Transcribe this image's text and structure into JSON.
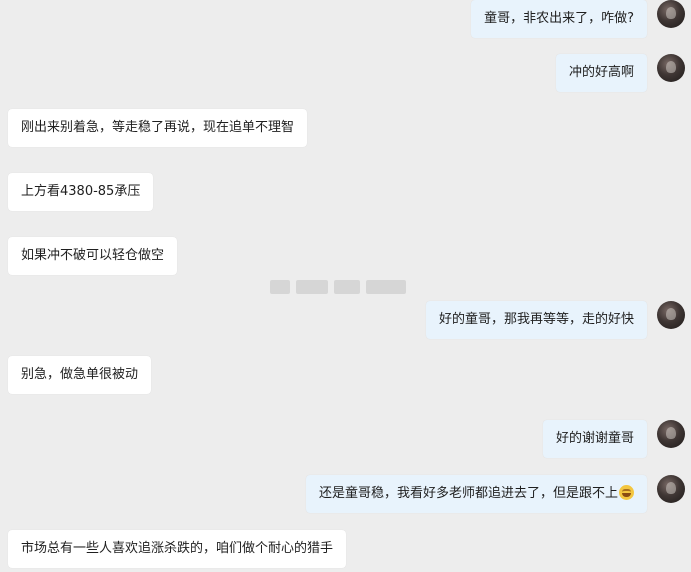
{
  "messages": [
    {
      "side": "out",
      "text": "童哥，非农出来了，咋做?"
    },
    {
      "side": "out",
      "text": "冲的好高啊"
    },
    {
      "side": "in",
      "text": "刚出来别着急，等走稳了再说，现在追单不理智"
    },
    {
      "side": "in",
      "text": "上方看4380-85承压"
    },
    {
      "side": "in",
      "text": "如果冲不破可以轻仓做空"
    },
    {
      "side": "out",
      "text": "好的童哥，那我再等等，走的好快"
    },
    {
      "side": "in",
      "text": "别急，做急单很被动"
    },
    {
      "side": "out",
      "text": "好的谢谢童哥"
    },
    {
      "side": "out",
      "text": "还是童哥稳，我看好多老师都追进去了，但是跟不上",
      "emoji": "laughing-tears-emoji"
    },
    {
      "side": "in",
      "text": "市场总有一些人喜欢追涨杀跌的，咱们做个耐心的猎手"
    }
  ]
}
